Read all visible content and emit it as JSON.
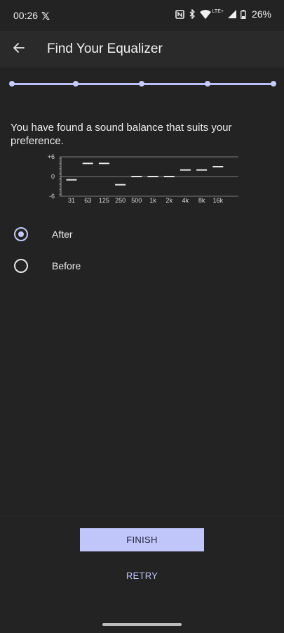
{
  "status_bar": {
    "time": "00:26",
    "battery": "26%",
    "network": "LTE+"
  },
  "app_bar": {
    "title": "Find Your Equalizer",
    "back_icon": "arrow-back-icon"
  },
  "progress": {
    "steps": 5,
    "current_step": 5
  },
  "result_text": "You have found a sound balance that suits your preference.",
  "chart_data": {
    "type": "bar",
    "categories": [
      "31",
      "63",
      "125",
      "250",
      "500",
      "1k",
      "2k",
      "4k",
      "8k",
      "16k"
    ],
    "values": [
      -1,
      4,
      4,
      -2.5,
      0,
      0,
      0,
      2,
      2,
      3
    ],
    "ylim": [
      -6,
      6
    ],
    "y_ticks": [
      "+6",
      "0",
      "-6"
    ],
    "grid": true,
    "colors": {
      "level": "#e8e8e8",
      "grid": "#9a9a9a"
    }
  },
  "options": [
    {
      "label": "After",
      "selected": true
    },
    {
      "label": "Before",
      "selected": false
    }
  ],
  "buttons": {
    "finish": "FINISH",
    "retry": "RETRY"
  },
  "colors": {
    "accent": "#c1c6fa",
    "background": "#232323",
    "app_bar": "#2a2a2a"
  }
}
